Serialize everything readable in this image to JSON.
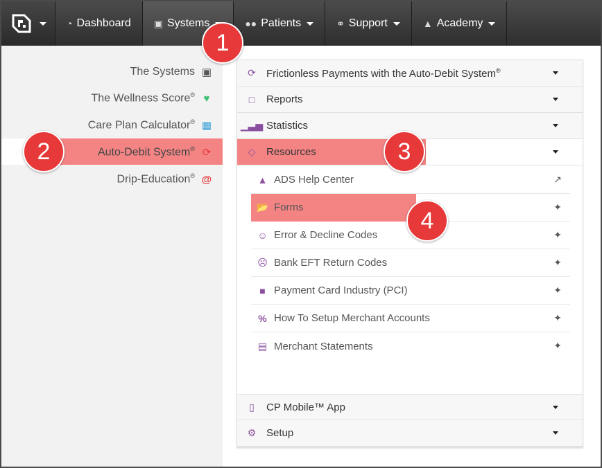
{
  "navbar": {
    "items": [
      {
        "label": "Dashboard",
        "icon": "dashboard-icon"
      },
      {
        "label": "Systems",
        "icon": "puzzle-icon"
      },
      {
        "label": "Patients",
        "icon": "users-icon"
      },
      {
        "label": "Support",
        "icon": "lifebuoy-icon"
      },
      {
        "label": "Academy",
        "icon": "graduation-cap-icon"
      }
    ]
  },
  "sidebar": {
    "items": [
      {
        "label": "The Systems",
        "icon": "puzzle-icon",
        "icon_color": "#555555"
      },
      {
        "label": "The Wellness Score",
        "reg": "®",
        "icon": "heartbeat-icon",
        "icon_color": "#3cbf74"
      },
      {
        "label": "Care Plan Calculator",
        "reg": "®",
        "icon": "calculator-icon",
        "icon_color": "#3aa0d8"
      },
      {
        "label": "Auto-Debit System",
        "reg": "®",
        "icon": "refresh-icon",
        "icon_color": "#e8393a"
      },
      {
        "label": "Drip-Education",
        "reg": "®",
        "icon": "at-sign-icon",
        "icon_color": "#e8393a"
      }
    ]
  },
  "accordion": {
    "sections": [
      {
        "label": "Frictionless Payments with the Auto-Debit System",
        "reg": "®",
        "icon": "refresh-icon"
      },
      {
        "label": "Reports",
        "icon": "file-icon"
      },
      {
        "label": "Statistics",
        "icon": "bar-chart-icon"
      },
      {
        "label": "Resources",
        "icon": "diamond-icon"
      },
      {
        "label": "CP Mobile™ App",
        "icon": "mobile-icon"
      },
      {
        "label": "Setup",
        "icon": "cogs-icon"
      }
    ],
    "resources": [
      {
        "label": "ADS Help Center",
        "icon": "graduation-cap-icon",
        "action_icon": "external-link-icon"
      },
      {
        "label": "Forms",
        "icon": "folder-open-icon",
        "action_icon": "pinwheel-icon"
      },
      {
        "label": "Error & Decline Codes",
        "icon": "smile-icon",
        "action_icon": "pinwheel-icon"
      },
      {
        "label": "Bank EFT Return Codes",
        "icon": "frown-icon",
        "action_icon": "pinwheel-icon"
      },
      {
        "label": "Payment Card Industry (PCI)",
        "icon": "lock-icon",
        "action_icon": "pinwheel-icon"
      },
      {
        "label": "How To Setup Merchant Accounts",
        "icon": "percent-icon",
        "action_icon": "pinwheel-icon"
      },
      {
        "label": "Merchant Statements",
        "icon": "bank-icon",
        "action_icon": "pinwheel-icon"
      }
    ]
  },
  "badges": [
    "1",
    "2",
    "3",
    "4"
  ],
  "colors": {
    "highlight": "#f48484",
    "badge": "#e8393a",
    "accent_purple": "#8a4f9e"
  }
}
